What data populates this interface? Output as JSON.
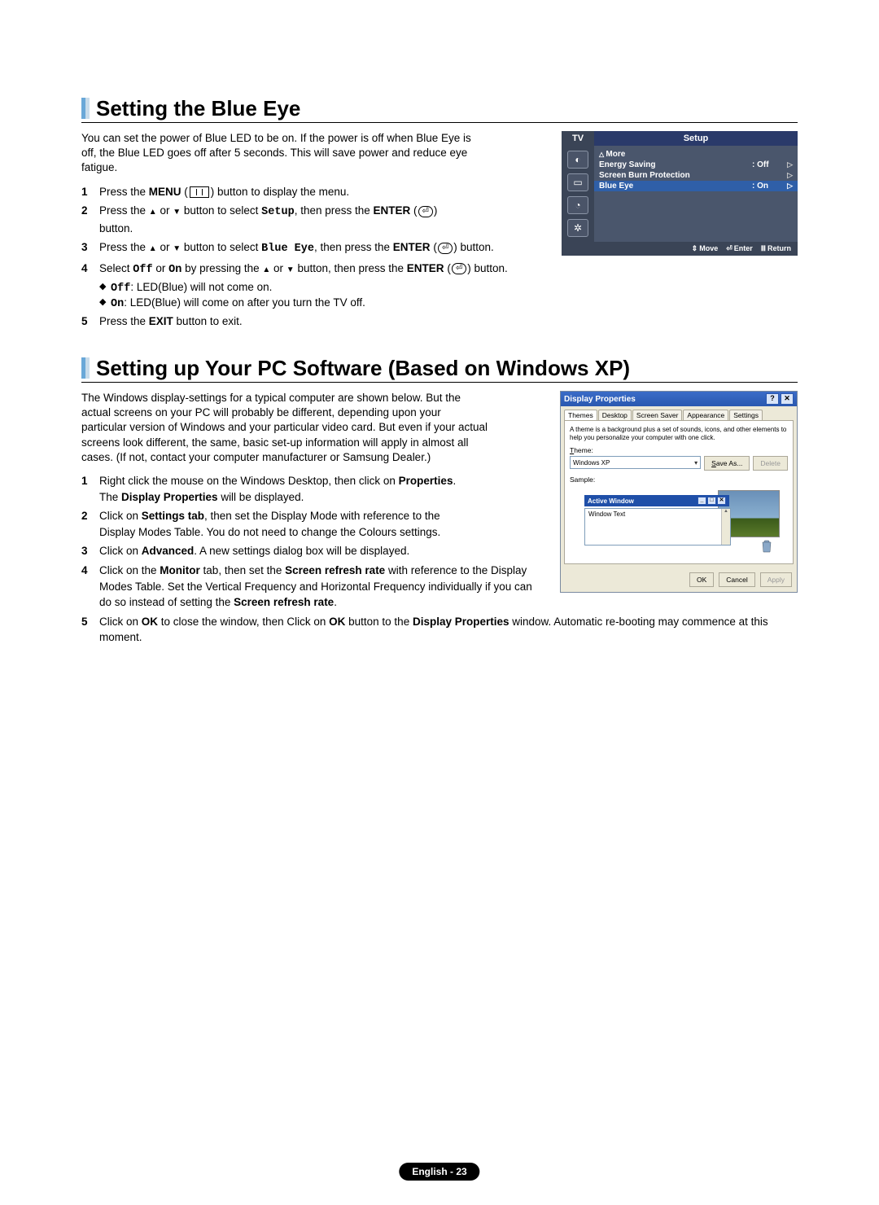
{
  "section1": {
    "heading": "Setting the Blue Eye",
    "intro": "You can set the power of Blue LED to be on. If the power is off when Blue Eye is off, the Blue LED goes off after 5 seconds. This will save power and reduce eye fatigue.",
    "steps": {
      "s1": {
        "num": "1",
        "a": "Press the ",
        "b": "MENU",
        "c": " button to display the menu."
      },
      "s2": {
        "num": "2",
        "a": "Press the ",
        "b": " or ",
        "c": " button to select ",
        "code": "Setup",
        "d": ", then press the ",
        "e": "ENTER",
        "f": " button."
      },
      "s3": {
        "num": "3",
        "a": "Press the ",
        "b": " or ",
        "c": " button to select ",
        "code": "Blue Eye",
        "d": ", then press the ",
        "e": "ENTER",
        "f": " button."
      },
      "s4": {
        "num": "4",
        "a": "Select ",
        "code1": "Off",
        "b": " or ",
        "code2": "On",
        "c": " by pressing the ",
        "d": " or ",
        "e": " button, then press the ",
        "f": "ENTER",
        "g": " button."
      },
      "bullets": {
        "b1": {
          "code": "Off",
          "text": ": LED(Blue) will not come on."
        },
        "b2": {
          "code": "On",
          "text": ": LED(Blue) will come on after you turn the TV off."
        }
      },
      "s5": {
        "num": "5",
        "a": "Press the ",
        "b": "EXIT",
        "c": " button to exit."
      }
    },
    "osd": {
      "tv": "TV",
      "setup": "Setup",
      "more": "More",
      "r1": {
        "label": "Energy Saving",
        "val": ": Off"
      },
      "r2": {
        "label": "Screen Burn Protection"
      },
      "r3": {
        "label": "Blue Eye",
        "val": ": On"
      },
      "foot": {
        "move": "Move",
        "enter": "Enter",
        "ret": "Return"
      }
    }
  },
  "section2": {
    "heading": "Setting up Your PC Software (Based on Windows XP)",
    "intro": "The Windows display-settings for a typical computer are shown below. But the actual screens on your PC will probably be different, depending upon your particular version of Windows and your particular video card. But even if your actual screens look different, the same, basic set-up information will apply in almost all cases. (If not, contact your computer manufacturer or Samsung Dealer.)",
    "steps": {
      "s1": {
        "num": "1",
        "a": "Right click the mouse on the Windows Desktop, then click on ",
        "b": "Properties",
        "c": ". The ",
        "d": "Display Properties",
        "e": " will be displayed."
      },
      "s2": {
        "num": "2",
        "a": "Click on ",
        "b": "Settings tab",
        "c": ", then set the Display Mode with reference to the Display Modes Table. You do not need to change the Colours settings."
      },
      "s3": {
        "num": "3",
        "a": "Click on ",
        "b": "Advanced",
        "c": ". A new settings dialog box will be displayed."
      },
      "s4": {
        "num": "4",
        "a": "Click on the ",
        "b": "Monitor",
        "c": " tab, then set the ",
        "d": "Screen refresh rate",
        "e": " with reference to the Display Modes Table. Set the Vertical Frequency and Horizontal Frequency individually if you can do so instead of setting the ",
        "f": "Screen refresh rate",
        "g": "."
      },
      "s5": {
        "num": "5",
        "a": "Click on ",
        "b": "OK",
        "c": " to close the window, then Click on ",
        "d": "OK",
        "e": " button to the ",
        "f": "Display Properties",
        "g": " window. Automatic re-booting may commence at this moment."
      }
    },
    "dp": {
      "title": "Display Properties",
      "tabs": {
        "t1": "Themes",
        "t2": "Desktop",
        "t3": "Screen Saver",
        "t4": "Appearance",
        "t5": "Settings"
      },
      "desc": "A theme is a background plus a set of sounds, icons, and other elements to help you personalize your computer with one click.",
      "lbl_theme": "Theme:",
      "theme_val": "Windows XP",
      "btn_saveas": "Save As...",
      "btn_delete": "Delete",
      "lbl_sample": "Sample:",
      "aw": "Active Window",
      "wt": "Window Text",
      "ok": "OK",
      "cancel": "Cancel",
      "apply": "Apply"
    }
  },
  "footer": "English - 23"
}
